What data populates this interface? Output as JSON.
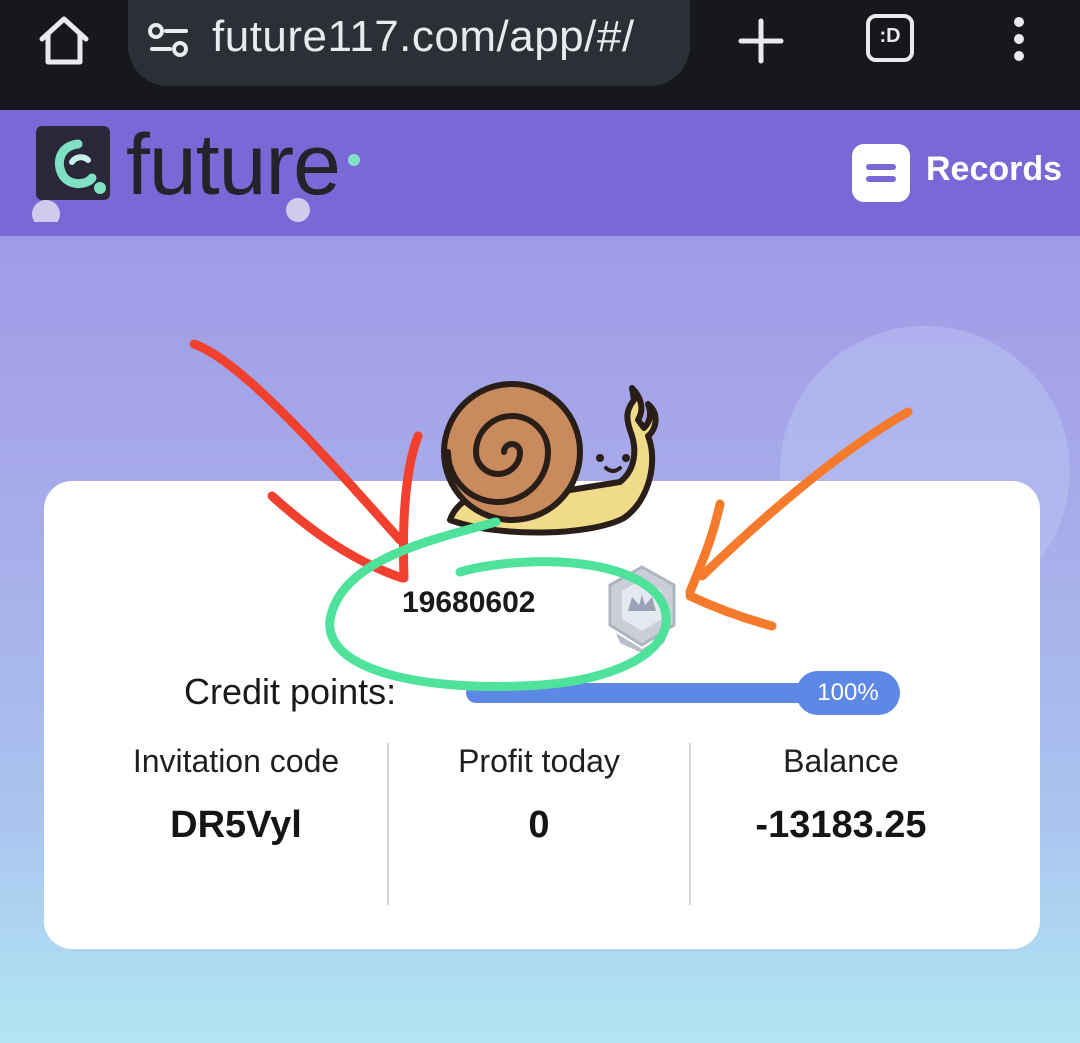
{
  "browser": {
    "url": "future117.com/app/#/",
    "tab_count": ":D"
  },
  "header": {
    "logo_text": "future",
    "records_label": "Records"
  },
  "profile": {
    "user_id": "19680602",
    "credit_label": "Credit points:",
    "credit_percent": 100,
    "credit_percent_text": "100%"
  },
  "stats": [
    {
      "label": "Invitation code",
      "value": "DR5Vyl"
    },
    {
      "label": "Profit today",
      "value": "0"
    },
    {
      "label": "Balance",
      "value": "-13183.25"
    }
  ],
  "colors": {
    "header_bg": "#7a68d6",
    "accent_blue": "#5e88e6",
    "annotation_red": "#f2402f",
    "annotation_orange": "#f57a2c",
    "annotation_green": "#4fe29a"
  },
  "icons": [
    "home-icon",
    "site-settings-icon",
    "plus-icon",
    "tab-switcher-icon",
    "more-vert-icon",
    "records-icon",
    "snail-avatar-icon",
    "vip-crown-badge-icon"
  ]
}
